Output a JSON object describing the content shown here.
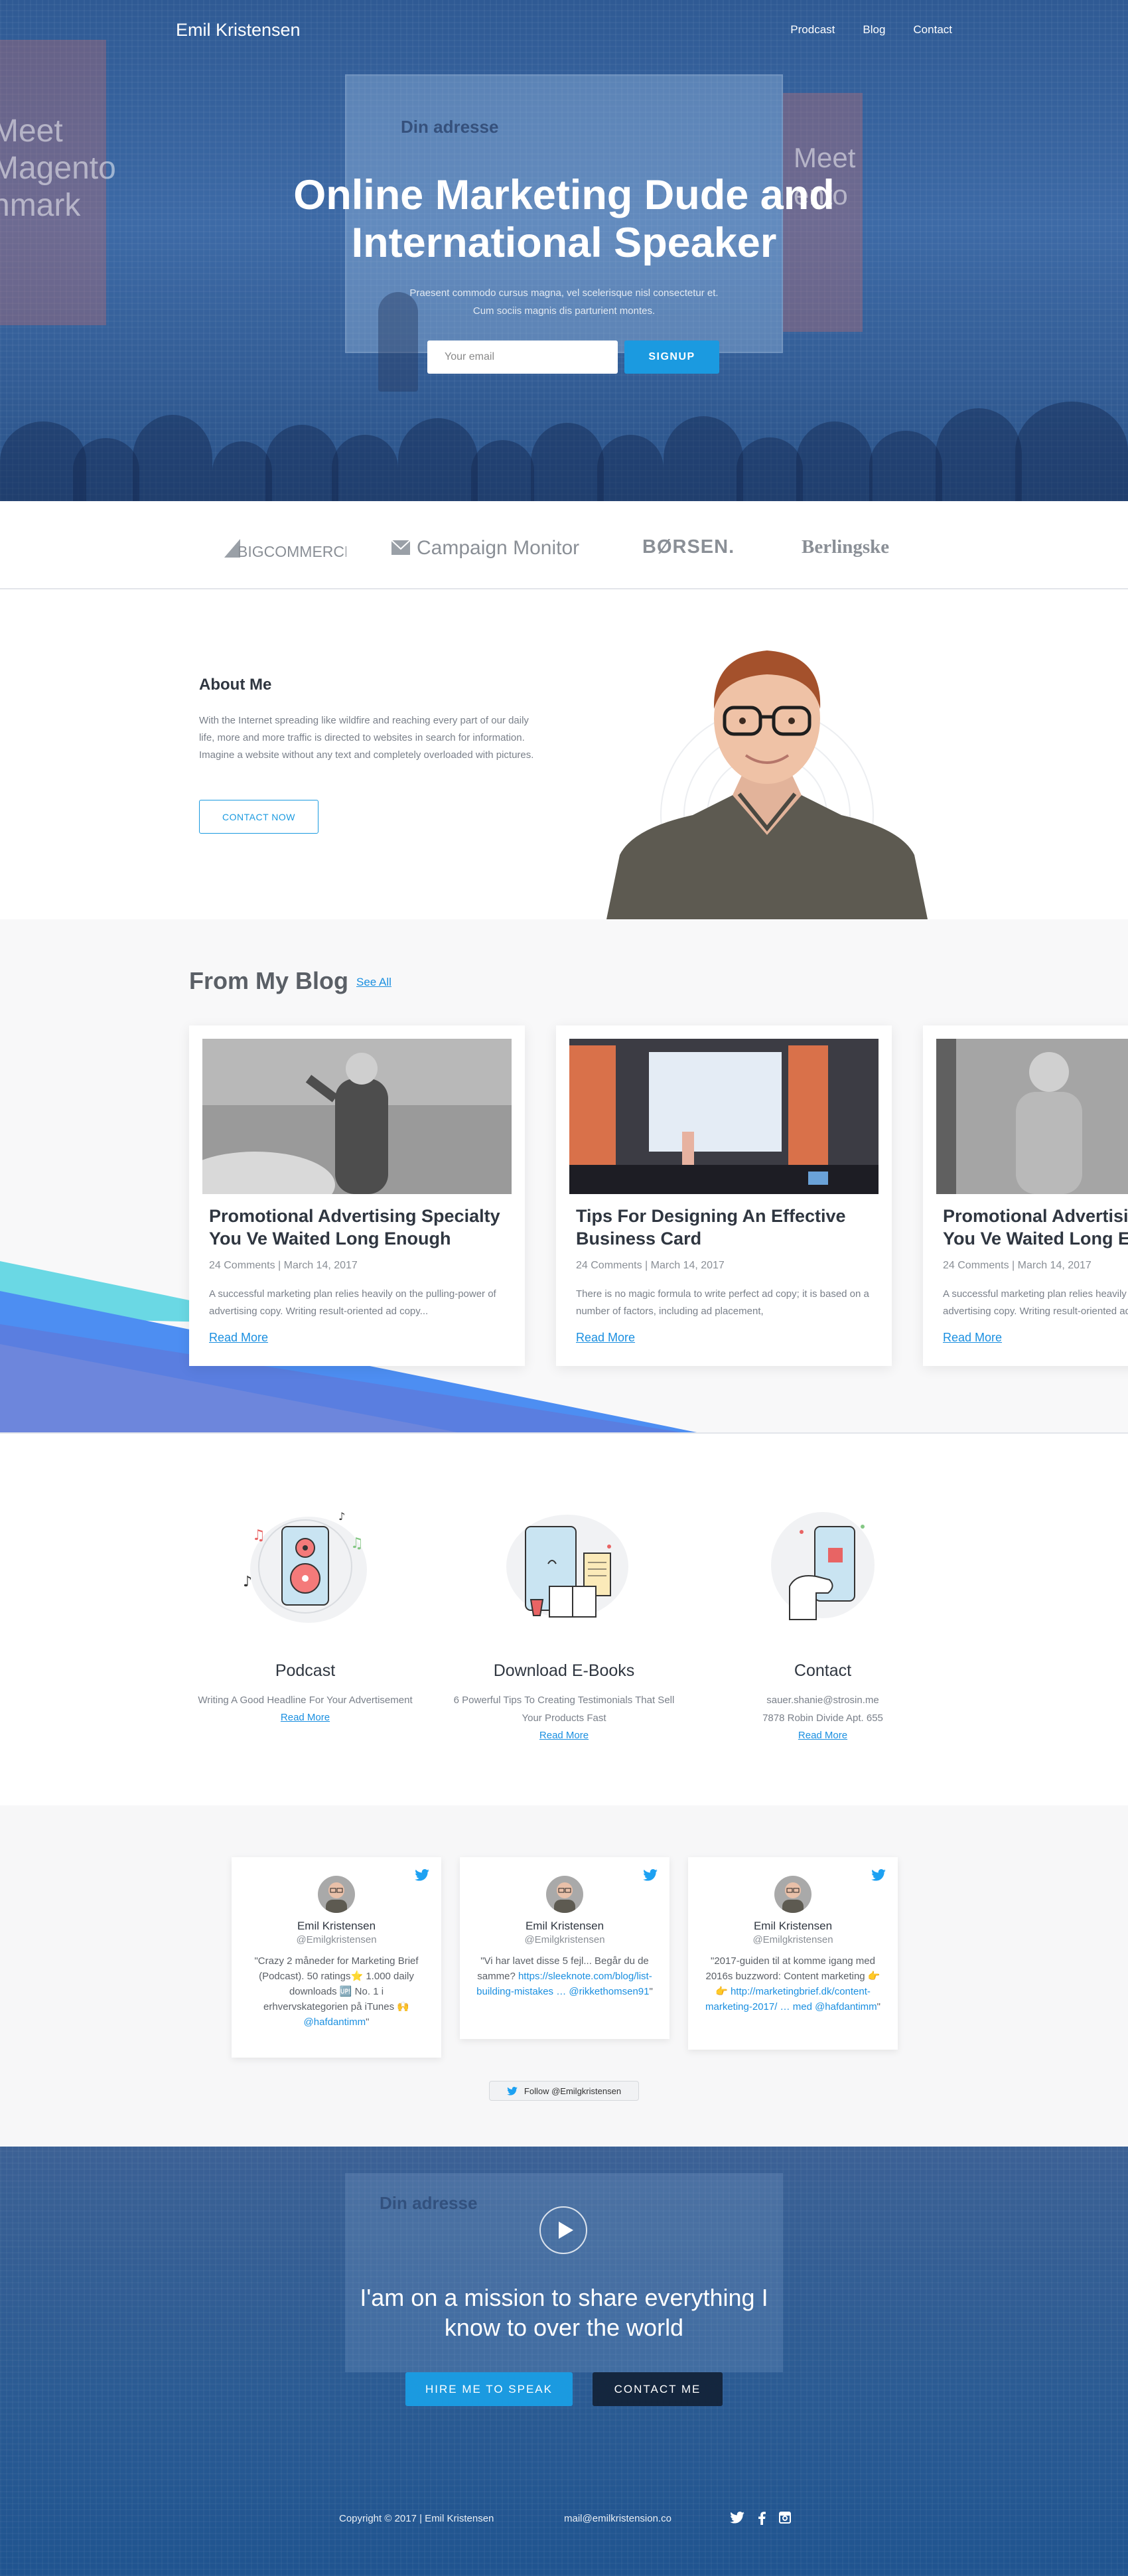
{
  "nav": {
    "brand": "Emil Kristensen",
    "items": [
      {
        "label": "Prodcast"
      },
      {
        "label": "Blog"
      },
      {
        "label": "Contact"
      }
    ]
  },
  "hero": {
    "screen_text": "Din adresse",
    "banner_left": "Meet\nMagento\nnmark",
    "banner_right": "Meet\nento",
    "title_line1": "Online Marketing Dude and",
    "title_line2": "International Speaker",
    "subtitle": "Praesent commodo cursus magna, vel scelerisque nisl consectetur et. Cum sociis magnis dis parturient montes.",
    "email_placeholder": "Your email",
    "signup_label": "SIGNUP"
  },
  "logos": [
    "BIGCOMMERCE",
    "Campaign Monitor",
    "BØRSEN.",
    "Berlingske"
  ],
  "about": {
    "heading": "About Me",
    "text": "With the Internet spreading like wildfire and reaching every part of our daily life, more and more traffic is directed to websites in search for information. Imagine a website without any text and completely overloaded with pictures.",
    "button": "CONTACT NOW"
  },
  "blog": {
    "heading": "From My Blog",
    "see_all": "See All",
    "posts": [
      {
        "title": "Promotional Advertising Specialty You Ve Waited Long Enough",
        "meta": "24 Comments | March 14, 2017",
        "excerpt": "A successful marketing plan relies heavily on the pulling-power of advertising copy. Writing result-oriented ad copy...",
        "read_more": "Read More"
      },
      {
        "title": "Tips For Designing An Effective Business Card",
        "meta": "24 Comments | March 14, 2017",
        "excerpt": "There is no magic formula to write perfect ad copy; it is based on a number of factors, including ad placement,",
        "read_more": "Read More"
      },
      {
        "title": "Promotional Advertising Specialty You Ve Waited Long Enough",
        "meta": "24 Comments | March 14, 2017",
        "excerpt": "A successful marketing plan relies heavily on the pulling-power of advertising copy. Writing result-oriented ad copy...",
        "read_more": "Read More"
      }
    ]
  },
  "services": [
    {
      "title": "Podcast",
      "text": "Writing A Good Headline For Your Advertisement",
      "link": "Read More"
    },
    {
      "title": "Download E-Books",
      "text": "6 Powerful Tips To Creating Testimonials That Sell Your Products Fast",
      "link": "Read More"
    },
    {
      "title": "Contact",
      "text": "sauer.shanie@strosin.me\n7878 Robin Divide Apt. 655",
      "link": "Read More"
    }
  ],
  "tweets": [
    {
      "name": "Emil Kristensen",
      "handle": "@Emilgkristensen",
      "text": "\"Crazy 2 måneder for Marketing Brief (Podcast). 50 ratings⭐ 1.000 daily downloads 🆙 No. 1 i erhvervskategorien på iTunes 🙌",
      "link": "@hafdantimm",
      "tail": "\""
    },
    {
      "name": "Emil Kristensen",
      "handle": "@Emilgkristensen",
      "text": "\"Vi har lavet disse 5 fejl... Begår du de samme? ",
      "link": "https://sleeknote.com/blog/list-building-mistakes … @rikkethomsen91",
      "tail": "\""
    },
    {
      "name": "Emil Kristensen",
      "handle": "@Emilgkristensen",
      "text": "\"2017-guiden til at komme igang med 2016s buzzword: Content marketing 👉👉 ",
      "link": "http://marketingbrief.dk/content-marketing-2017/ … med @hafdantimm",
      "tail": "\""
    }
  ],
  "follow_label": "Follow @Emilgkristensen",
  "mission": {
    "screen_text": "Din adresse",
    "text": "I'am on a mission to share everything I know to over the world",
    "hire_label": "HIRE ME TO SPEAK",
    "contact_label": "CONTACT ME"
  },
  "footer": {
    "copyright": "Copyright © 2017 | Emil Kristensen",
    "email": "mail@emilkristension.co"
  },
  "colors": {
    "accent": "#1b9ae0",
    "hero_blue": "#2f5a94",
    "dark_button": "#14263e"
  }
}
